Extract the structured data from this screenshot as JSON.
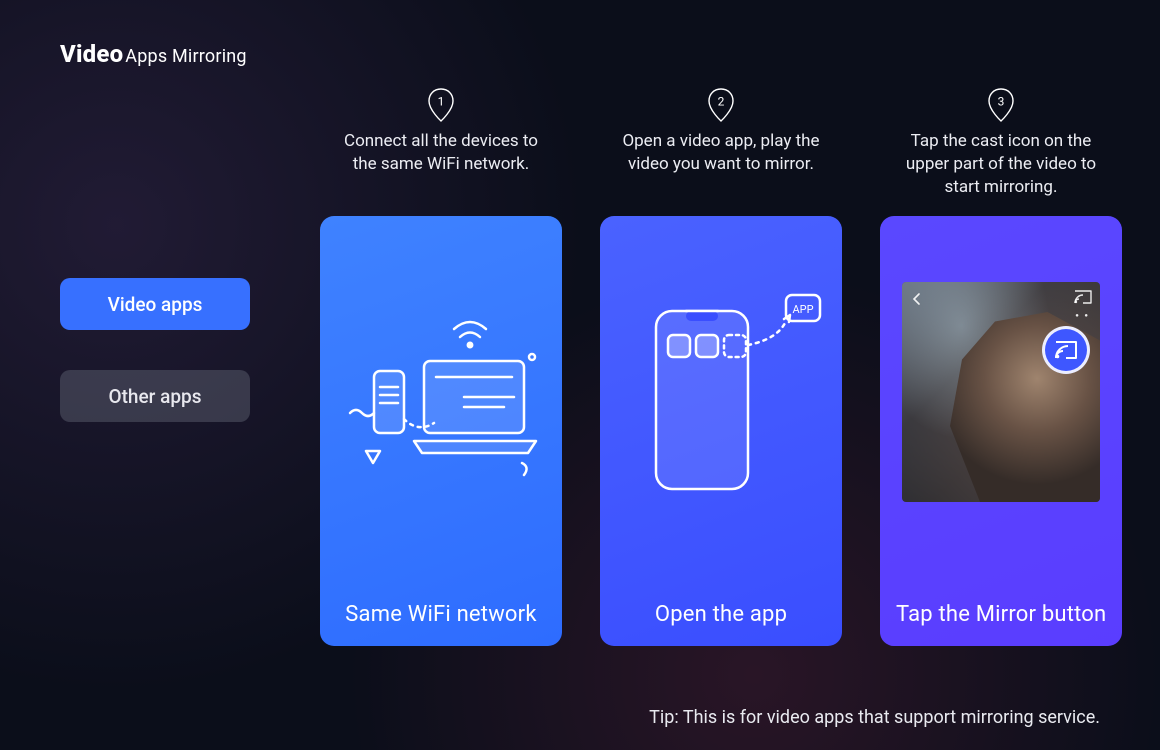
{
  "header": {
    "title_bold": "Video",
    "title_rest": "Apps Mirroring"
  },
  "tabs": {
    "active": "Video apps",
    "inactive": "Other apps"
  },
  "steps": [
    {
      "num": "1",
      "desc": "Connect all the devices to the same WiFi network.",
      "caption": "Same WiFi network"
    },
    {
      "num": "2",
      "desc": "Open a video app, play the video you want to mirror.",
      "caption": "Open the app"
    },
    {
      "num": "3",
      "desc": "Tap the cast icon on the upper part of the video to start mirroring.",
      "caption": "Tap the Mirror button"
    }
  ],
  "tip": "Tip: This is for video apps that support mirroring service.",
  "icons": {
    "app_label": "APP"
  }
}
